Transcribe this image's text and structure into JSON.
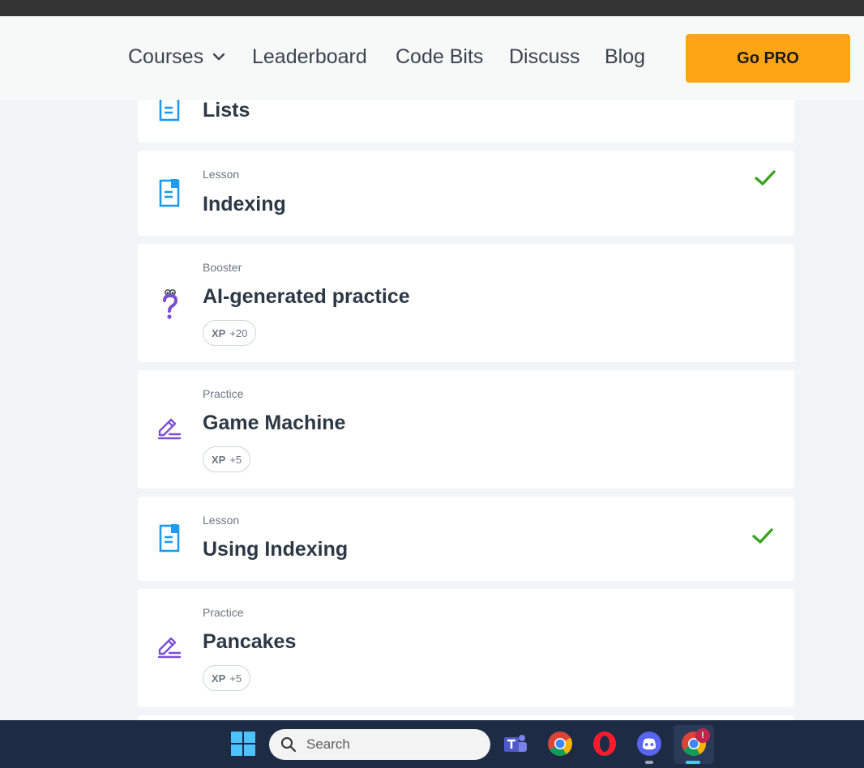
{
  "nav": {
    "items": [
      "Courses",
      "Leaderboard",
      "Code Bits",
      "Discuss",
      "Blog"
    ],
    "cta": "Go PRO"
  },
  "cards": [
    {
      "kind": "",
      "title": "Lists",
      "xp_label": "",
      "xp_value": "",
      "completed": false,
      "icon": "lesson-icon"
    },
    {
      "kind": "Lesson",
      "title": "Indexing",
      "xp_label": "",
      "xp_value": "",
      "completed": true,
      "icon": "lesson-icon"
    },
    {
      "kind": "Booster",
      "title": "AI-generated practice",
      "xp_label": "XP",
      "xp_value": "+20",
      "completed": false,
      "icon": "question-icon"
    },
    {
      "kind": "Practice",
      "title": "Game Machine",
      "xp_label": "XP",
      "xp_value": "+5",
      "completed": false,
      "icon": "pencil-icon"
    },
    {
      "kind": "Lesson",
      "title": "Using Indexing",
      "xp_label": "",
      "xp_value": "",
      "completed": true,
      "icon": "lesson-icon"
    },
    {
      "kind": "Practice",
      "title": "Pancakes",
      "xp_label": "XP",
      "xp_value": "+5",
      "completed": false,
      "icon": "pencil-icon"
    }
  ],
  "taskbar": {
    "search_placeholder": "Search",
    "badge": "!"
  },
  "colors": {
    "accent": "#fea516",
    "lesson_icon": "#1d9bf0",
    "practice_icon": "#7b4fd3",
    "check": "#3aa320"
  }
}
